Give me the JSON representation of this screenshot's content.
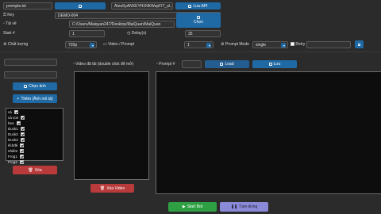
{
  "toolbar": {
    "prompts_file": "prompts.txt",
    "folder_button": "",
    "api_key_masked": "AIzaSyANXEYH1NKWspFIT_eL",
    "save_api_label": "Lưu API"
  },
  "config": {
    "key_label": "Key",
    "key_value": "DEMO-004",
    "save_to_label": "Tải về",
    "save_to_value": "C:/Users/Maiquan247/Desktop/MaiQuan/MaiQuan",
    "choose_label": "Chọn",
    "start_label": "Start #",
    "start_value": "1",
    "delay_label": "Delay(s)",
    "delay_value": "35",
    "quality_label": "Chất lượng",
    "quality_value": "720p",
    "video_prompt_label": "Video / Prompt",
    "video_prompt_value": "1",
    "prompt_mode_label": "Prompt Mode",
    "prompt_mode_value": "single",
    "retry_label": "Retry",
    "retry_value": ""
  },
  "left_panel": {
    "input1": "",
    "input2": "",
    "choose_image_label": "Chọn ảnh",
    "add_image_label": "Thêm (Ảnh mô tả)",
    "delete_label": "Xóa",
    "samples": [
      {
        "name": "cá",
        "checked": true
      },
      {
        "name": "cá con",
        "checked": true
      },
      {
        "name": "heo",
        "checked": true
      },
      {
        "name": "Duck1",
        "checked": true
      },
      {
        "name": "Duck2",
        "checked": true
      },
      {
        "name": "Duck3",
        "checked": true
      },
      {
        "name": "ếchđẻ",
        "checked": true
      },
      {
        "name": "nhiêm",
        "checked": true
      },
      {
        "name": "Frog1",
        "checked": true
      },
      {
        "name": "Frog2",
        "checked": true
      }
    ]
  },
  "middle_panel": {
    "title": "Video đã tải (double click để mở)",
    "delete_video_label": "Xóa Video"
  },
  "right_panel": {
    "prompt_label": "Prompt #",
    "prompt_value": "",
    "load_label": "Load",
    "save_label": "Lưu"
  },
  "footer": {
    "start_label": "Start Bot",
    "pause_label": "Tạm dừng"
  },
  "colors": {
    "background": "#2b2b2b",
    "accent_blue": "#1f6aa5",
    "danger_red": "#b83a3a",
    "start_green": "#2ea043",
    "pause_purple": "#8a8ad8"
  }
}
